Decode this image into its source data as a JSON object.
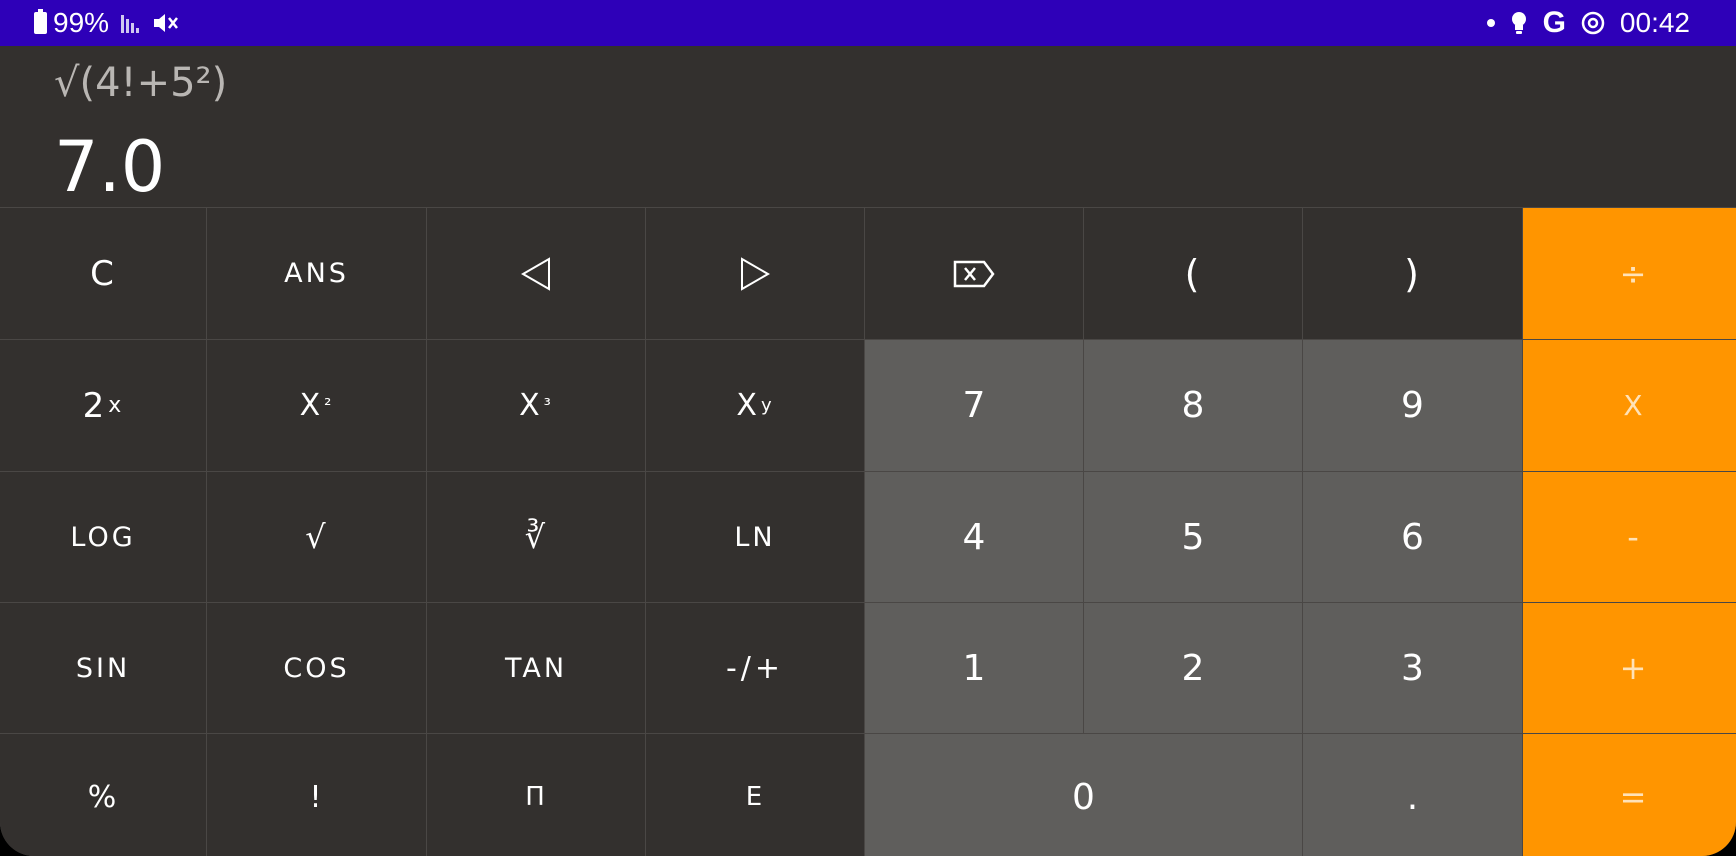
{
  "status_bar": {
    "battery": "99%",
    "time": "00:42",
    "icons": [
      "battery-icon",
      "signal-icon",
      "mute-icon",
      "dot-icon",
      "bulb-icon",
      "google-icon",
      "sync-icon"
    ],
    "google_letter": "G"
  },
  "display": {
    "expression": "√(4!+5²)",
    "result": "7.0"
  },
  "keys": {
    "clear": "C",
    "ans": "ANS",
    "cursor_left": "◁",
    "cursor_right": "▷",
    "open_paren": "(",
    "close_paren": ")",
    "divide": "÷",
    "pow2x_base": "2",
    "pow2x_exp": "x",
    "square_base": "X",
    "square_exp": "²",
    "cube_base": "X",
    "cube_exp": "³",
    "power_base": "X",
    "power_exp": "y",
    "seven": "7",
    "eight": "8",
    "nine": "9",
    "multiply": "X",
    "log": "LOG",
    "sqrt": "√",
    "cbrt": "∛",
    "ln": "LN",
    "four": "4",
    "five": "5",
    "six": "6",
    "minus": "-",
    "sin": "SIN",
    "cos": "COS",
    "tan": "TAN",
    "negate": "-/+",
    "one": "1",
    "two": "2",
    "three": "3",
    "plus": "+",
    "percent": "%",
    "factorial": "!",
    "pi": "Π",
    "e": "E",
    "zero": "0",
    "decimal": ".",
    "equals": "="
  },
  "colors": {
    "status_bar": "#2e00b8",
    "background": "#33302e",
    "number_key": "#5f5e5c",
    "operator_key": "#ff9500",
    "divider": "#4a4745"
  }
}
